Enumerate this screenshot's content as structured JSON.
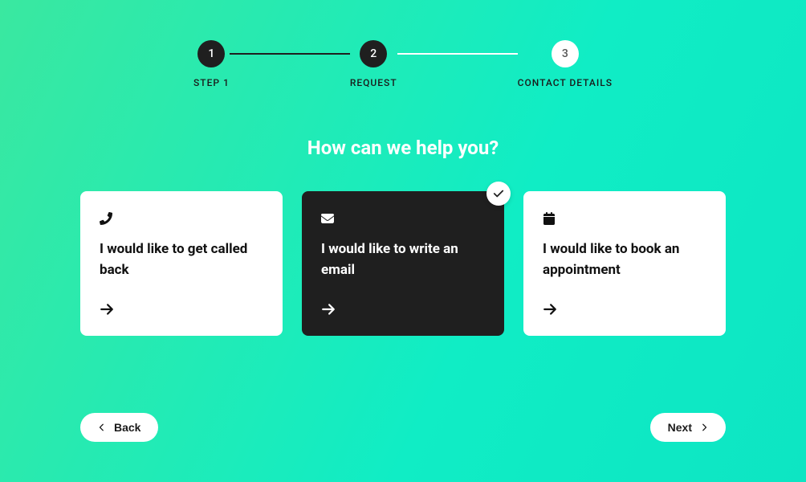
{
  "stepper": {
    "steps": [
      {
        "number": "1",
        "label": "STEP 1",
        "active": true
      },
      {
        "number": "2",
        "label": "REQUEST",
        "active": true
      },
      {
        "number": "3",
        "label": "CONTACT DETAILS",
        "active": false
      }
    ]
  },
  "heading": "How can we help you?",
  "options": [
    {
      "icon": "phone",
      "title": "I would like to get called back",
      "selected": false
    },
    {
      "icon": "envelope",
      "title": "I would like to write an email",
      "selected": true
    },
    {
      "icon": "calendar",
      "title": "I would like to book an appointment",
      "selected": false
    }
  ],
  "nav": {
    "back": "Back",
    "next": "Next"
  }
}
